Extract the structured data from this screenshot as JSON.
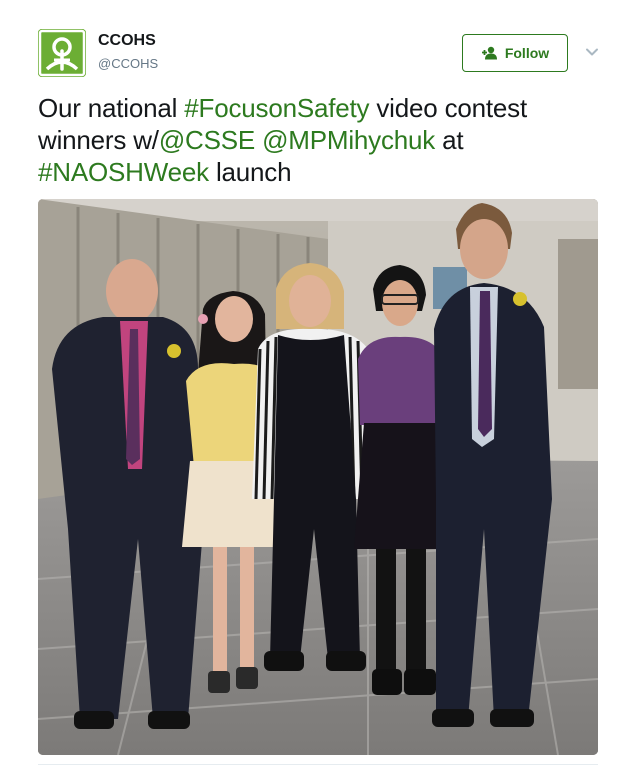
{
  "account": {
    "name": "CCOHS",
    "handle": "@CCOHS",
    "avatar_icon": "ccohs-logo",
    "brand_color": "#6cae34"
  },
  "follow_button": {
    "label": "Follow",
    "icon": "add-user-icon",
    "color": "#2d7a1f"
  },
  "menu": {
    "icon": "chevron-down-icon"
  },
  "tweet": {
    "text_1": "Our national ",
    "hashtag_1": "#FocusonSafety",
    "text_2": " video contest winners w/",
    "mention_1": "@CSSE",
    "text_3": " ",
    "mention_2": "@MPMihychuk",
    "text_4": " at ",
    "hashtag_2": "#NAOSHWeek",
    "text_5": " launch",
    "link_color": "#2d7a1f"
  },
  "media": {
    "type": "photo"
  }
}
